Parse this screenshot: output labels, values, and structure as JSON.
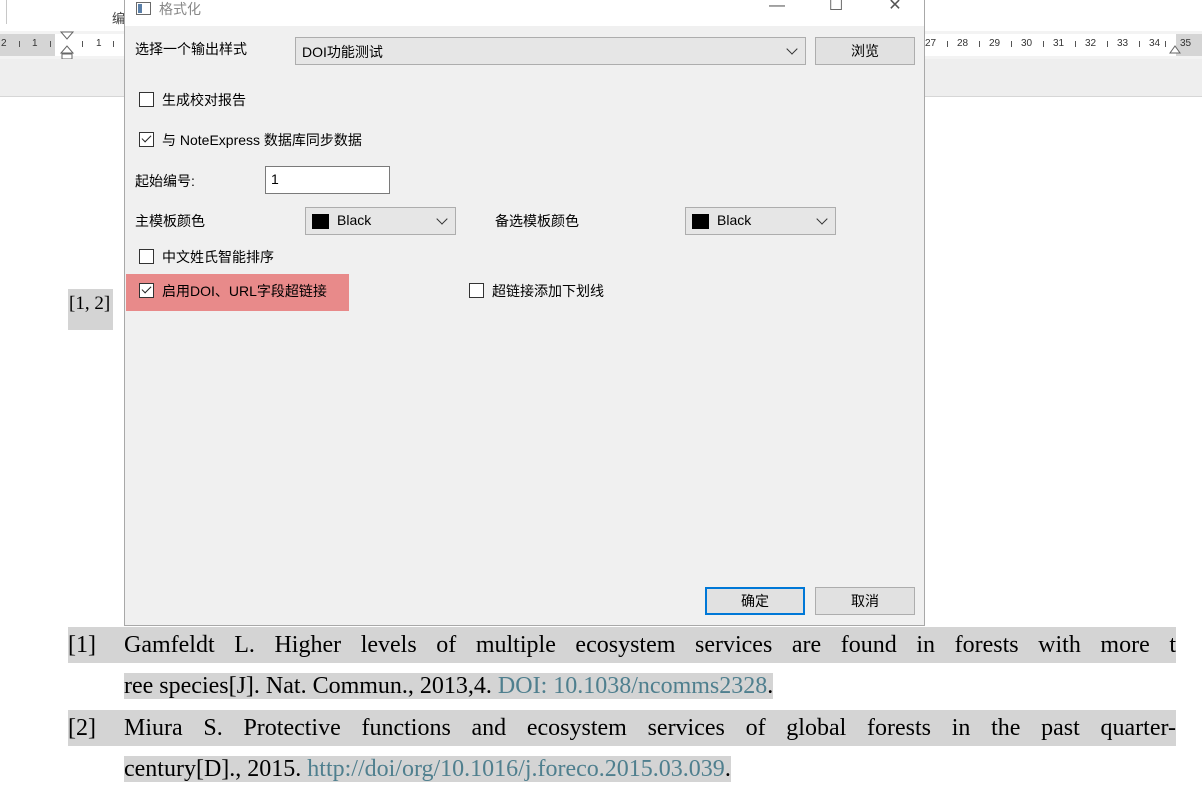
{
  "background": {
    "top_label": "编",
    "ruler": {
      "left_numbers": [
        "2",
        "1",
        "1",
        "1"
      ],
      "right_numbers": [
        "27",
        "28",
        "29",
        "30",
        "31",
        "32",
        "33",
        "34",
        "35"
      ]
    },
    "citation": "[1, 2]",
    "references": [
      {
        "number": "[1]",
        "line1": "Gamfeldt L. Higher levels of multiple ecosystem services are found in forests with more t",
        "line2_text": "ree species[J]. Nat. Commun., 2013,4. ",
        "line2_link": "DOI: 10.1038/ncomms2328",
        "line2_end": "."
      },
      {
        "number": "[2]",
        "line1": "Miura S. Protective functions and ecosystem services of global forests in the past quarter-",
        "line2_text": "century[D]., 2015. ",
        "line2_link": "http://doi/org/10.1016/j.foreco.2015.03.039",
        "line2_end": "."
      }
    ],
    "link_color": "#4f7f8e"
  },
  "dialog": {
    "title": "格式化",
    "window_buttons": {
      "minimize": "—",
      "maximize": "☐",
      "close": "✕"
    },
    "style_label": "选择一个输出样式",
    "style_value": "DOI功能测试",
    "browse_button": "浏览",
    "proof_report": {
      "label": "生成校对报告",
      "checked": false
    },
    "sync": {
      "label": "与 NoteExpress 数据库同步数据",
      "checked": true
    },
    "start_number": {
      "label": "起始编号:",
      "value": "1"
    },
    "main_color": {
      "label": "主模板颜色",
      "value": "Black",
      "swatch": "#000000"
    },
    "alt_color": {
      "label": "备选模板颜色",
      "value": "Black",
      "swatch": "#000000"
    },
    "chinese_sort": {
      "label": "中文姓氏智能排序",
      "checked": false
    },
    "enable_link": {
      "label": "启用DOI、URL字段超链接",
      "checked": true,
      "highlight": "#e88a8a"
    },
    "underline_link": {
      "label": "超链接添加下划线",
      "checked": false
    },
    "ok_button": "确定",
    "cancel_button": "取消",
    "accent": "#0078d7"
  }
}
